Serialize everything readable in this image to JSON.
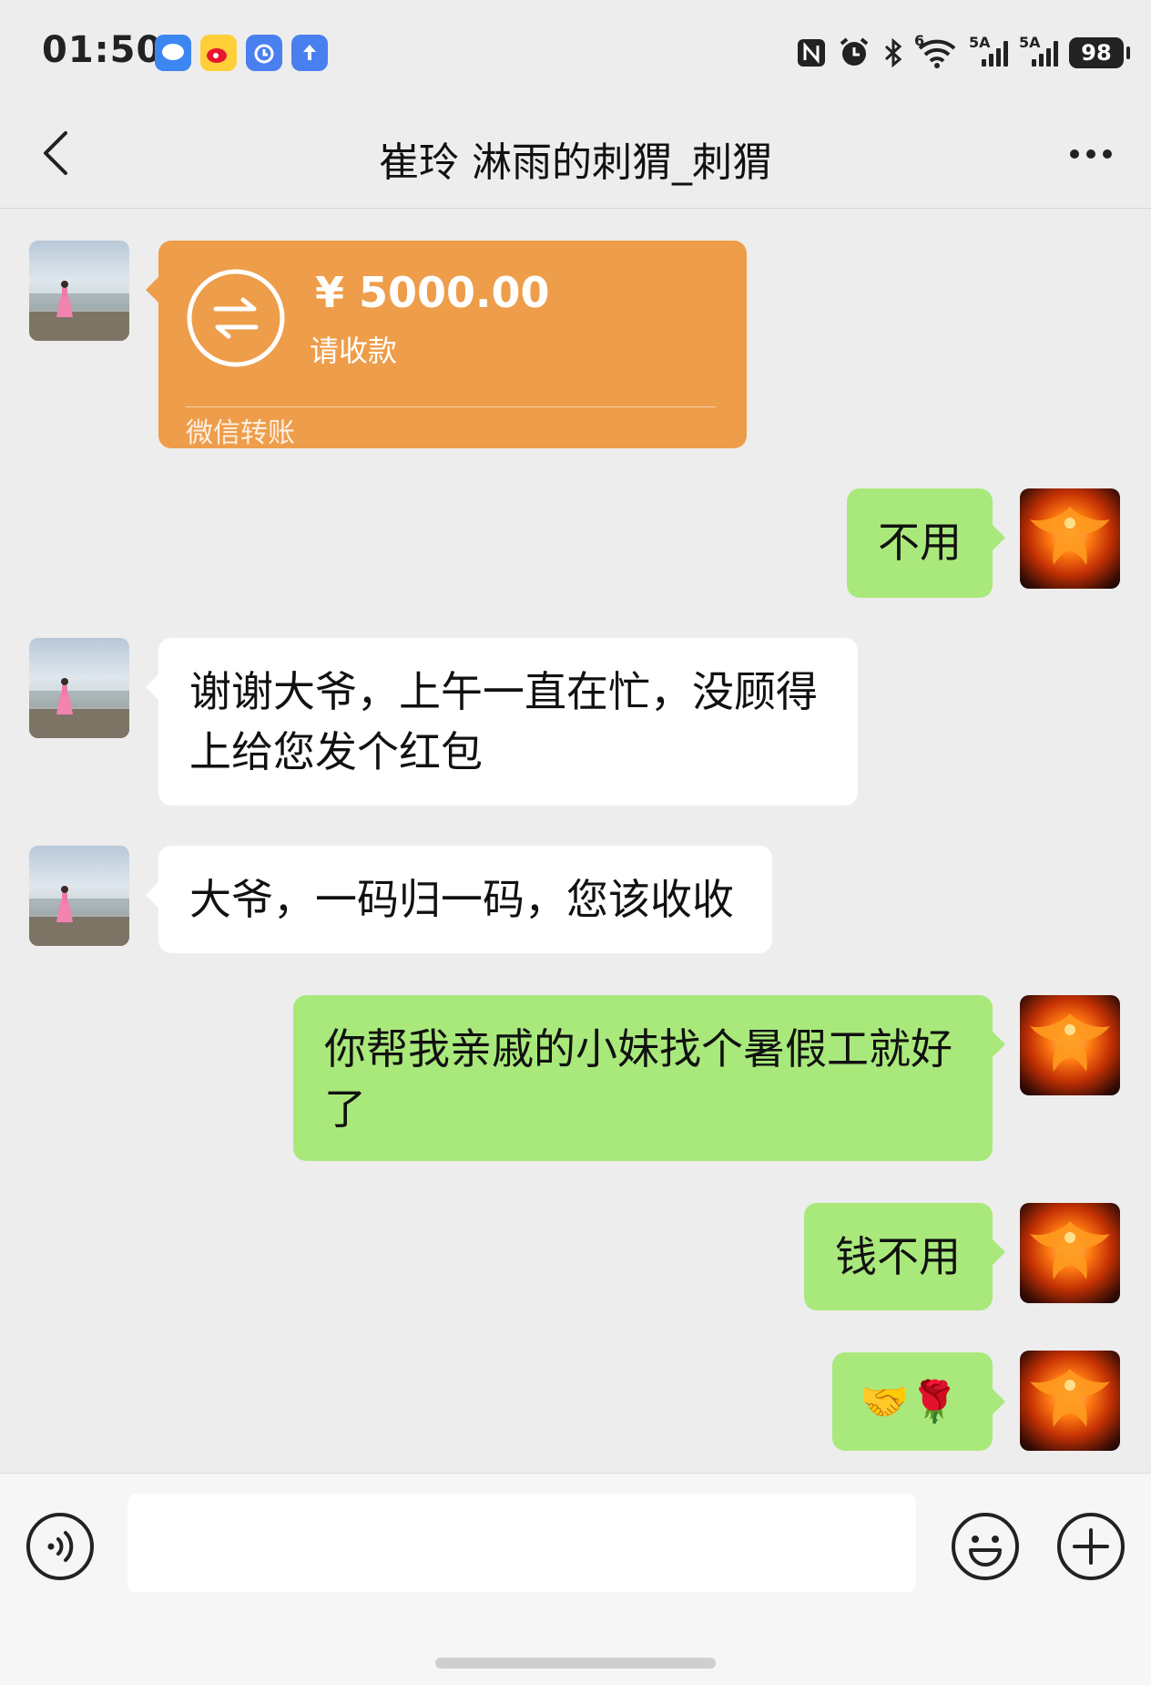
{
  "status_bar": {
    "time": "01:50",
    "signal1": "5A",
    "signal2": "5A",
    "wifi_label": "6",
    "battery": "98"
  },
  "header": {
    "title": "崔玲 淋雨的刺猬_刺猬"
  },
  "messages": [
    {
      "side": "left",
      "type": "transfer",
      "amount": "¥ 5000.00",
      "subtitle": "请收款",
      "source": "微信转账"
    },
    {
      "side": "right",
      "type": "text",
      "text": "不用"
    },
    {
      "side": "left",
      "type": "text",
      "line1": "谢谢大爷，上午一直在忙，没顾得",
      "line2": "上给您发个红包"
    },
    {
      "side": "left",
      "type": "text",
      "text": "大爷，一码归一码，您该收收"
    },
    {
      "side": "right",
      "type": "text",
      "line1": "你帮我亲戚的小妹找个暑假工就好",
      "line2": "了"
    },
    {
      "side": "right",
      "type": "text",
      "text": "钱不用"
    },
    {
      "side": "right",
      "type": "emoji",
      "text": "🤝🌹"
    }
  ],
  "input": {
    "placeholder": ""
  }
}
